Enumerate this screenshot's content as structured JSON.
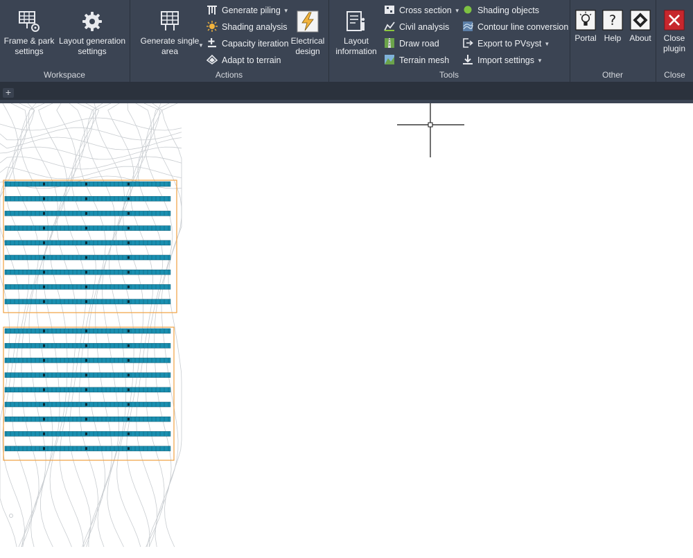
{
  "ribbon": {
    "groups": [
      {
        "name": "Workspace"
      },
      {
        "name": "Actions"
      },
      {
        "name": "Tools"
      },
      {
        "name": "Other"
      },
      {
        "name": "Close"
      }
    ],
    "workspace": {
      "frame_park": "Frame & park\nsettings",
      "layout_generation": "Layout generation\nsettings"
    },
    "actions": {
      "generate_single_area": "Generate single\narea",
      "generate_piling": "Generate piling",
      "shading_analysis": "Shading analysis",
      "capacity_iteration": "Capacity iteration",
      "adapt_to_terrain": "Adapt to terrain",
      "electrical_design": "Electrical\ndesign"
    },
    "tools": {
      "layout_information": "Layout\ninformation",
      "cross_section": "Cross section",
      "civil_analysis": "Civil analysis",
      "draw_road": "Draw road",
      "terrain_mesh": "Terrain mesh",
      "shading_objects": "Shading objects",
      "contour_line_conversion": "Contour line conversion",
      "export_to_pvsyst": "Export to PVsyst",
      "import_settings": "Import settings"
    },
    "other": {
      "portal": "Portal",
      "help": "Help",
      "about": "About"
    },
    "close": {
      "close_plugin": "Close\nplugin"
    }
  },
  "tabbar": {
    "add": "+"
  },
  "colors": {
    "ribbon_bg": "#3b4453",
    "panel_row": "#1a8fb0",
    "boundary": "#f0a040",
    "contour": "#c8ccd0",
    "close_red": "#c7272d"
  },
  "canvas": {
    "block_count": 2,
    "rows_per_block": 9
  }
}
